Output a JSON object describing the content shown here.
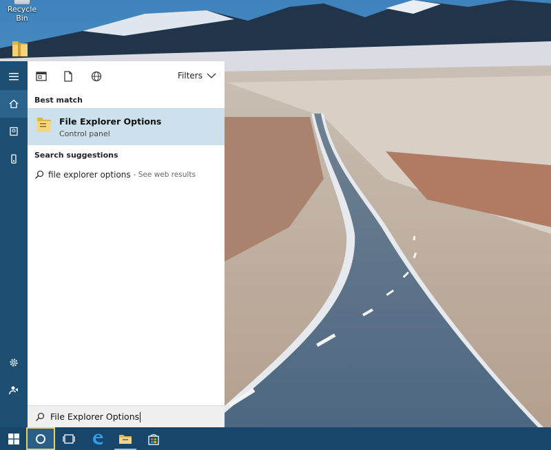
{
  "desktop": {
    "recycle_bin_label": "Recycle Bin"
  },
  "rail": {
    "items": [
      {
        "name": "hamburger-icon"
      },
      {
        "name": "home-icon"
      },
      {
        "name": "notebook-icon"
      },
      {
        "name": "phone-icon"
      },
      {
        "name": "settings-icon"
      },
      {
        "name": "feedback-icon"
      }
    ]
  },
  "toolbar": {
    "filters_label": "Filters",
    "icons": [
      "apps-icon",
      "documents-icon",
      "web-icon"
    ]
  },
  "results": {
    "best_match_label": "Best match",
    "best_match": {
      "title": "File Explorer Options",
      "subtitle": "Control panel"
    },
    "suggestions_label": "Search suggestions",
    "suggestions": [
      {
        "text": "file explorer options",
        "hint": "- See web results"
      }
    ]
  },
  "search": {
    "value": "File Explorer Options"
  },
  "taskbar": {
    "items": [
      "start-button",
      "cortana-button",
      "task-view-button",
      "edge-button",
      "file-explorer-button",
      "store-button"
    ]
  },
  "colors": {
    "rail": "#1d4f73",
    "taskbar": "#18466a",
    "selection": "#cde1ec",
    "cortana_highlight": "#e9d06b"
  }
}
